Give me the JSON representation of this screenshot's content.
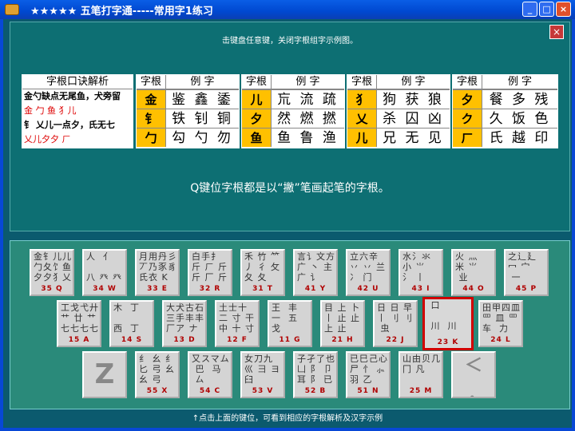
{
  "window": {
    "title": "★★★★★ 五笔打字通-----常用字1练习",
    "min": "_",
    "max": "□",
    "close": "×"
  },
  "panel": {
    "hint": "击键盘任意键，关闭字根组字示例图。",
    "close": "×",
    "rhyme": {
      "title": "字根口诀解析",
      "lines": [
        "金勺缺点无尾鱼，犬旁留",
        "金 勹 鱼 犭儿",
        "钅 乂儿一点夕，氏无七",
        "乂儿夕夕 ㄏ"
      ]
    },
    "tables": [
      {
        "h1": "字根",
        "h2": "例  字",
        "rows": [
          {
            "r": "金",
            "ex": "鉴 鑫 鋈"
          },
          {
            "r": "钅",
            "ex": "铁 钊 铜"
          },
          {
            "r": "勹",
            "ex": "勾 勺 勿"
          }
        ]
      },
      {
        "h1": "字根",
        "h2": "例  字",
        "rows": [
          {
            "r": "儿",
            "ex": "巟 流 疏"
          },
          {
            "r": "夕",
            "ex": "然 燃 撚"
          },
          {
            "r": "鱼",
            "ex": "鱼 鲁 渔"
          }
        ]
      },
      {
        "h1": "字根",
        "h2": "例  字",
        "rows": [
          {
            "r": "犭",
            "ex": "狗 获 狼"
          },
          {
            "r": "乂",
            "ex": "杀 囚 凶"
          },
          {
            "r": "儿",
            "ex": "兄 无 见"
          }
        ]
      },
      {
        "h1": "字根",
        "h2": "例  字",
        "rows": [
          {
            "r": "夕",
            "ex": "餐 多 残"
          },
          {
            "r": "ク",
            "ex": "久 饭 色"
          },
          {
            "r": "ㄏ",
            "ex": "氏 越 印"
          }
        ]
      }
    ],
    "description": "Q键位字根都是以“撇”笔画起笔的字根。"
  },
  "keys": [
    {
      "g": "金钅儿儿\n勹夂饣鱼\n夕夕犭乂",
      "c": "35 Q"
    },
    {
      "g": "人  亻\n\n八 癶 癶",
      "c": "34 W"
    },
    {
      "g": "月用丹彡\n丆乃豕豸\n氏衣 K",
      "c": "33 E"
    },
    {
      "g": "白手扌\n斤 ㄏ 斤\n斤 厂 斤",
      "c": "32 R"
    },
    {
      "g": "禾 竹 ⺮\n丿 彳 攵\n夂 夂",
      "c": "31 T"
    },
    {
      "g": "言讠文方\n广 丶 主\n广 讠",
      "c": "41 Y"
    },
    {
      "g": "立六辛\n丷 丷 兰\n冫 门",
      "c": "42 U"
    },
    {
      "g": "水氵氺\n小 ⺌\n氵 丨",
      "c": "43 I"
    },
    {
      "g": "火 灬\n米 ⺌\n 业",
      "c": "44 O"
    },
    {
      "g": "之辶廴\n冖 宀\n 一",
      "c": "45 P"
    },
    {
      "g": "工戈弋廾\n艹 廿 艹\n七七七七",
      "c": "15 A"
    },
    {
      "g": "木  丁\n\n西  丁",
      "c": "14 S"
    },
    {
      "g": "大犬古石\n三手丰丰\n厂ア ナ",
      "c": "13 D"
    },
    {
      "g": "土士十\n二 寸 干\n中 十 寸",
      "c": "12 F"
    },
    {
      "g": "王  丰\n一  五\n戈",
      "c": "11 G"
    },
    {
      "g": "目 上 卜\n丨 止 止\n上 止",
      "c": "21 H"
    },
    {
      "g": "日 日 早\n丨 刂 刂\n 虫",
      "c": "22 J"
    },
    {
      "g": " 口\n\n 川  川",
      "c": "23 K",
      "sel": true
    },
    {
      "g": "田甲四皿\n罒 皿 罒\n车  力",
      "c": "24 L"
    },
    {
      "g": "Z",
      "big": true
    },
    {
      "g": "纟 幺 纟\n匕 弓 幺\n幺 弓",
      "c": "55 X"
    },
    {
      "g": "又スマム\n 巴  马\n ㄙ",
      "c": "54 C"
    },
    {
      "g": "女刀九\n巛 彐 ヨ\n臼",
      "c": "53 V"
    },
    {
      "g": "子孑了也\n凵 阝 卩\n耳 阝 已",
      "c": "52 B"
    },
    {
      "g": "已巳己心\n尸 忄 ⺗\n羽 乙",
      "c": "51 N"
    },
    {
      "g": "山由贝几\n冂 凡\n ",
      "c": "25 M"
    },
    {
      "g": "＜\n\n ，",
      "big": true,
      "small": true
    }
  ],
  "status": "↑点击上面的键位，可看到相应的字根解析及汉字示例"
}
